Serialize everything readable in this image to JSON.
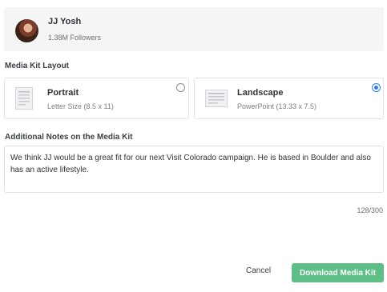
{
  "profile": {
    "name": "JJ Yosh",
    "followers": "1.38M Followers"
  },
  "media_kit_layout": {
    "label": "Media Kit Layout",
    "options": [
      {
        "title": "Portrait",
        "subtitle": "Letter Size (8.5 x 11)",
        "selected": false,
        "icon": "portrait-document-icon"
      },
      {
        "title": "Landscape",
        "subtitle": "PowerPoint (13.33 x 7.5)",
        "selected": true,
        "icon": "landscape-document-icon"
      }
    ]
  },
  "notes": {
    "label": "Additional Notes on the Media Kit",
    "value": "We think JJ would be a great fit for our next Visit Colorado campaign. He is based in Boulder and also has an active lifestyle.",
    "char_count": "128/300"
  },
  "actions": {
    "cancel_label": "Cancel",
    "download_label": "Download Media Kit"
  },
  "colors": {
    "accent_green": "#5dbe86",
    "radio_blue": "#2d7ff9",
    "card_bg": "#f5f5f5"
  }
}
